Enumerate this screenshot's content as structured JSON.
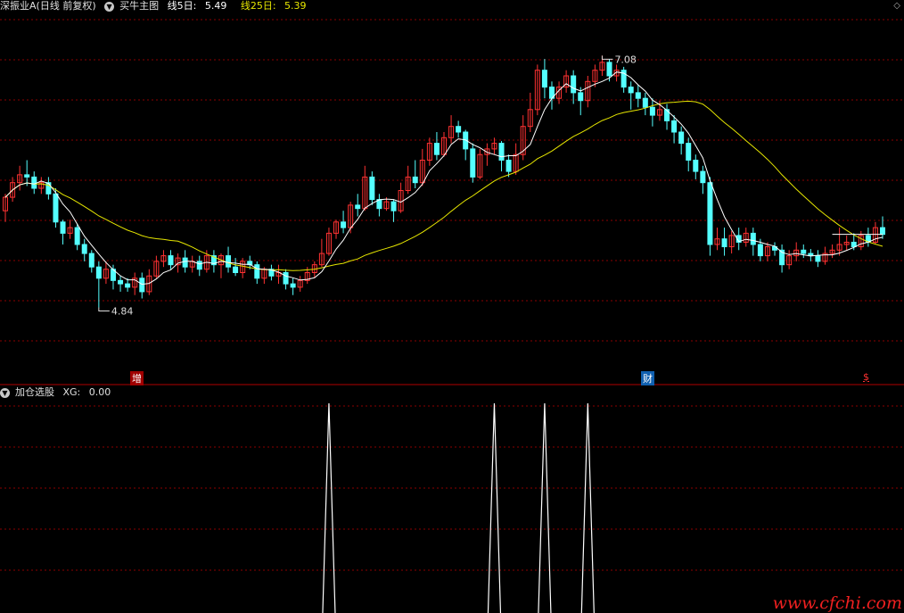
{
  "header": {
    "stock_name": "深振业A",
    "period_label": "(日线 前复权)",
    "indicator": "买牛主图",
    "ma5_label": "线5日:",
    "ma5_value": "5.49",
    "ma25_label": "线25日:",
    "ma25_value": "5.39",
    "collapse_icon": "chevron-down-icon",
    "corner_icon": "diamond-icon"
  },
  "sub_header": {
    "indicator": "加仓选股",
    "xg_label": "XG:",
    "xg_value": "0.00"
  },
  "markers": {
    "high_label": "7.08",
    "low_label": "4.84",
    "event_1": "增",
    "event_2": "财",
    "event_3": "$"
  },
  "watermark": "www.cfchi.com",
  "colors": {
    "up": "#ff3232",
    "down": "#54ffff",
    "ma5": "#ffffff",
    "ma25": "#e6e600",
    "grid": "#8b0000",
    "separator": "#b00000"
  },
  "chart_data": [
    {
      "type": "candlestick",
      "title": "买牛主图",
      "series": [
        {
          "name": "线5日",
          "last": 5.49
        },
        {
          "name": "线25日",
          "last": 5.39
        }
      ],
      "ylim": [
        4.4,
        7.4
      ],
      "high": 7.08,
      "low": 4.84,
      "candles": [
        [
          5.7,
          5.82,
          5.6,
          5.85
        ],
        [
          5.82,
          5.95,
          5.78,
          6.0
        ],
        [
          5.95,
          6.02,
          5.88,
          6.1
        ],
        [
          6.02,
          6.0,
          5.92,
          6.15
        ],
        [
          6.0,
          5.9,
          5.85,
          6.05
        ],
        [
          5.9,
          5.95,
          5.85,
          6.0
        ],
        [
          5.95,
          5.85,
          5.8,
          6.0
        ],
        [
          5.85,
          5.6,
          5.55,
          5.9
        ],
        [
          5.6,
          5.5,
          5.4,
          5.62
        ],
        [
          5.5,
          5.55,
          5.45,
          5.62
        ],
        [
          5.55,
          5.4,
          5.35,
          5.58
        ],
        [
          5.4,
          5.32,
          5.25,
          5.45
        ],
        [
          5.32,
          5.2,
          5.15,
          5.35
        ],
        [
          5.2,
          5.1,
          4.84,
          5.25
        ],
        [
          5.1,
          5.18,
          5.05,
          5.25
        ],
        [
          5.18,
          5.08,
          5.0,
          5.22
        ],
        [
          5.08,
          5.05,
          4.98,
          5.12
        ],
        [
          5.05,
          5.02,
          4.98,
          5.1
        ],
        [
          5.02,
          5.1,
          4.95,
          5.15
        ],
        [
          5.1,
          4.98,
          4.92,
          5.15
        ],
        [
          4.98,
          5.12,
          4.95,
          5.18
        ],
        [
          5.12,
          5.25,
          5.1,
          5.3
        ],
        [
          5.25,
          5.3,
          5.2,
          5.35
        ],
        [
          5.3,
          5.22,
          5.18,
          5.35
        ],
        [
          5.22,
          5.28,
          5.15,
          5.32
        ],
        [
          5.28,
          5.2,
          5.15,
          5.35
        ],
        [
          5.2,
          5.25,
          5.15,
          5.3
        ],
        [
          5.25,
          5.18,
          5.12,
          5.3
        ],
        [
          5.18,
          5.3,
          5.15,
          5.35
        ],
        [
          5.3,
          5.22,
          5.15,
          5.35
        ],
        [
          5.22,
          5.3,
          5.1,
          5.32
        ],
        [
          5.3,
          5.2,
          5.15,
          5.38
        ],
        [
          5.2,
          5.15,
          5.12,
          5.28
        ],
        [
          5.15,
          5.25,
          5.1,
          5.28
        ],
        [
          5.25,
          5.22,
          5.18,
          5.3
        ],
        [
          5.22,
          5.1,
          5.05,
          5.25
        ],
        [
          5.1,
          5.18,
          5.05,
          5.2
        ],
        [
          5.18,
          5.12,
          5.08,
          5.22
        ],
        [
          5.12,
          5.15,
          5.05,
          5.22
        ],
        [
          5.15,
          5.05,
          5.0,
          5.18
        ],
        [
          5.05,
          5.02,
          4.95,
          5.1
        ],
        [
          5.02,
          5.08,
          4.98,
          5.12
        ],
        [
          5.08,
          5.15,
          5.05,
          5.2
        ],
        [
          5.15,
          5.22,
          5.1,
          5.25
        ],
        [
          5.22,
          5.32,
          5.2,
          5.45
        ],
        [
          5.32,
          5.5,
          5.3,
          5.55
        ],
        [
          5.5,
          5.6,
          5.45,
          5.62
        ],
        [
          5.6,
          5.55,
          5.5,
          5.7
        ],
        [
          5.55,
          5.75,
          5.5,
          5.78
        ],
        [
          5.75,
          5.72,
          5.65,
          5.85
        ],
        [
          5.72,
          6.0,
          5.7,
          6.1
        ],
        [
          6.0,
          5.8,
          5.75,
          6.05
        ],
        [
          5.8,
          5.72,
          5.65,
          5.85
        ],
        [
          5.72,
          5.78,
          5.7,
          5.82
        ],
        [
          5.78,
          5.7,
          5.6,
          5.8
        ],
        [
          5.7,
          5.88,
          5.68,
          5.95
        ],
        [
          5.88,
          6.0,
          5.85,
          6.1
        ],
        [
          6.0,
          5.95,
          5.9,
          6.15
        ],
        [
          5.95,
          6.15,
          5.92,
          6.25
        ],
        [
          6.15,
          6.3,
          6.1,
          6.35
        ],
        [
          6.3,
          6.2,
          6.15,
          6.4
        ],
        [
          6.2,
          6.35,
          6.18,
          6.4
        ],
        [
          6.35,
          6.45,
          6.3,
          6.55
        ],
        [
          6.45,
          6.4,
          6.35,
          6.5
        ],
        [
          6.4,
          6.25,
          6.15,
          6.42
        ],
        [
          6.25,
          6.0,
          5.95,
          6.3
        ],
        [
          6.0,
          6.2,
          5.98,
          6.25
        ],
        [
          6.2,
          6.25,
          6.1,
          6.3
        ],
        [
          6.25,
          6.3,
          6.2,
          6.35
        ],
        [
          6.3,
          6.15,
          6.05,
          6.32
        ],
        [
          6.15,
          6.05,
          6.0,
          6.2
        ],
        [
          6.05,
          6.2,
          6.02,
          6.3
        ],
        [
          6.2,
          6.45,
          6.15,
          6.55
        ],
        [
          6.45,
          6.6,
          6.4,
          6.75
        ],
        [
          6.6,
          6.95,
          6.55,
          7.0
        ],
        [
          6.95,
          6.8,
          6.7,
          7.05
        ],
        [
          6.8,
          6.7,
          6.6,
          6.85
        ],
        [
          6.7,
          6.8,
          6.65,
          6.85
        ],
        [
          6.8,
          6.9,
          6.75,
          6.95
        ],
        [
          6.9,
          6.75,
          6.65,
          6.95
        ],
        [
          6.75,
          6.68,
          6.55,
          6.8
        ],
        [
          6.68,
          6.85,
          6.62,
          6.9
        ],
        [
          6.85,
          6.95,
          6.8,
          7.0
        ],
        [
          6.95,
          7.02,
          6.9,
          7.08
        ],
        [
          7.02,
          6.9,
          6.85,
          7.05
        ],
        [
          6.9,
          6.95,
          6.85,
          7.0
        ],
        [
          6.95,
          6.8,
          6.75,
          6.98
        ],
        [
          6.8,
          6.75,
          6.6,
          6.85
        ],
        [
          6.75,
          6.7,
          6.62,
          6.82
        ],
        [
          6.7,
          6.62,
          6.55,
          6.75
        ],
        [
          6.62,
          6.55,
          6.45,
          6.7
        ],
        [
          6.55,
          6.6,
          6.5,
          6.68
        ],
        [
          6.6,
          6.5,
          6.42,
          6.65
        ],
        [
          6.5,
          6.4,
          6.3,
          6.55
        ],
        [
          6.4,
          6.3,
          6.2,
          6.45
        ],
        [
          6.3,
          6.15,
          6.05,
          6.35
        ],
        [
          6.15,
          6.05,
          5.98,
          6.2
        ],
        [
          6.05,
          5.95,
          5.85,
          6.1
        ],
        [
          5.95,
          5.4,
          5.3,
          6.0
        ],
        [
          5.4,
          5.45,
          5.35,
          5.55
        ],
        [
          5.45,
          5.38,
          5.3,
          5.55
        ],
        [
          5.38,
          5.48,
          5.32,
          5.52
        ],
        [
          5.48,
          5.42,
          5.35,
          5.55
        ],
        [
          5.42,
          5.5,
          5.38,
          5.55
        ],
        [
          5.5,
          5.4,
          5.3,
          5.55
        ],
        [
          5.4,
          5.3,
          5.25,
          5.45
        ],
        [
          5.3,
          5.38,
          5.25,
          5.42
        ],
        [
          5.38,
          5.35,
          5.3,
          5.42
        ],
        [
          5.35,
          5.22,
          5.15,
          5.4
        ],
        [
          5.22,
          5.3,
          5.18,
          5.35
        ],
        [
          5.3,
          5.35,
          5.25,
          5.42
        ],
        [
          5.35,
          5.32,
          5.28,
          5.4
        ],
        [
          5.32,
          5.3,
          5.25,
          5.36
        ],
        [
          5.3,
          5.25,
          5.2,
          5.35
        ],
        [
          5.25,
          5.32,
          5.22,
          5.38
        ],
        [
          5.32,
          5.35,
          5.28,
          5.4
        ],
        [
          5.35,
          5.4,
          5.3,
          5.55
        ],
        [
          5.4,
          5.42,
          5.35,
          5.48
        ],
        [
          5.42,
          5.38,
          5.35,
          5.5
        ],
        [
          5.38,
          5.48,
          5.35,
          5.52
        ],
        [
          5.48,
          5.42,
          5.38,
          5.55
        ],
        [
          5.42,
          5.55,
          5.4,
          5.6
        ],
        [
          5.55,
          5.49,
          5.45,
          5.65
        ]
      ]
    },
    {
      "type": "line",
      "title": "加仓选股",
      "series": [
        {
          "name": "XG",
          "last": 0.0
        }
      ],
      "ylim": [
        0,
        1
      ],
      "spikes_at": [
        45,
        68,
        75,
        81
      ]
    }
  ]
}
